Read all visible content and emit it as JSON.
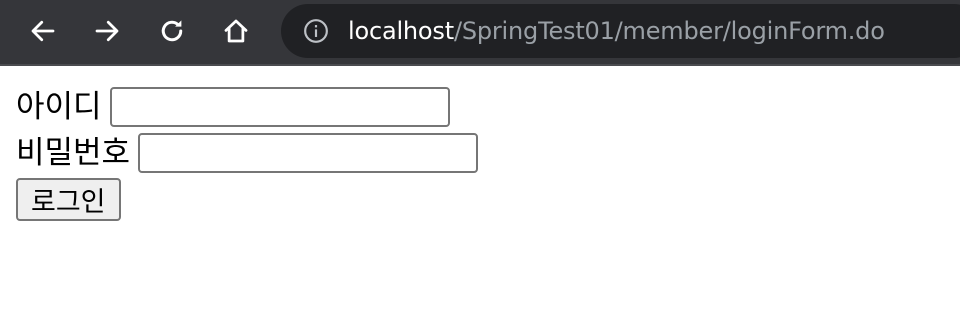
{
  "browser": {
    "url_host": "localhost",
    "url_path": "/SpringTest01/member/loginForm.do",
    "nav_icons": [
      "back-arrow-icon",
      "forward-arrow-icon",
      "reload-icon",
      "home-icon"
    ],
    "site_info_icon": "info-icon",
    "colors": {
      "toolbar_bg": "#35363a",
      "omnibox_bg": "#202124",
      "host_text": "#ffffff",
      "path_text": "#9aa0a6"
    }
  },
  "form": {
    "id_label": "아이디",
    "id_value": "",
    "password_label": "비밀번호",
    "password_value": "",
    "submit_label": "로그인"
  }
}
